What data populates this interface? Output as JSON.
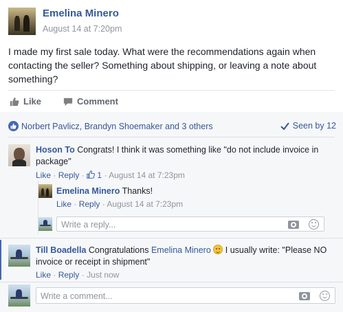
{
  "post": {
    "author": "Emelina Minero",
    "timestamp": "August 14 at 7:20pm",
    "text": "I made my first sale today. What were the recommendations again when contacting the seller? Something about shipping, or leaving a note about something?"
  },
  "actions": {
    "like_label": "Like",
    "comment_label": "Comment"
  },
  "reactions": {
    "summary": "Norbert Pavlicz, Brandyn Shoemaker and 3 others",
    "seen_label": "Seen by 12"
  },
  "comments": [
    {
      "author": "Hoson To",
      "text": "Congrats! I think it was something like \"do not include invoice in package\"",
      "like_label": "Like",
      "reply_label": "Reply",
      "like_count": "1",
      "timestamp": "August 14 at 7:23pm",
      "replies": [
        {
          "author": "Emelina Minero",
          "text": "Thanks!",
          "like_label": "Like",
          "reply_label": "Reply",
          "timestamp": "August 14 at 7:23pm"
        }
      ],
      "reply_placeholder": "Write a reply..."
    },
    {
      "author": "Till Boadella",
      "text_before": "Congratulations",
      "mention": "Emelina Minero",
      "text_after": "I usually write: \"Please NO invoice or receipt in shipment\"",
      "like_label": "Like",
      "reply_label": "Reply",
      "timestamp": "Just now"
    }
  ],
  "composer": {
    "placeholder": "Write a comment..."
  },
  "separator": "·",
  "colors": {
    "link": "#365899",
    "meta": "#90949c",
    "accent": "#4267b2",
    "comment_bg": "#f6f7f9"
  }
}
